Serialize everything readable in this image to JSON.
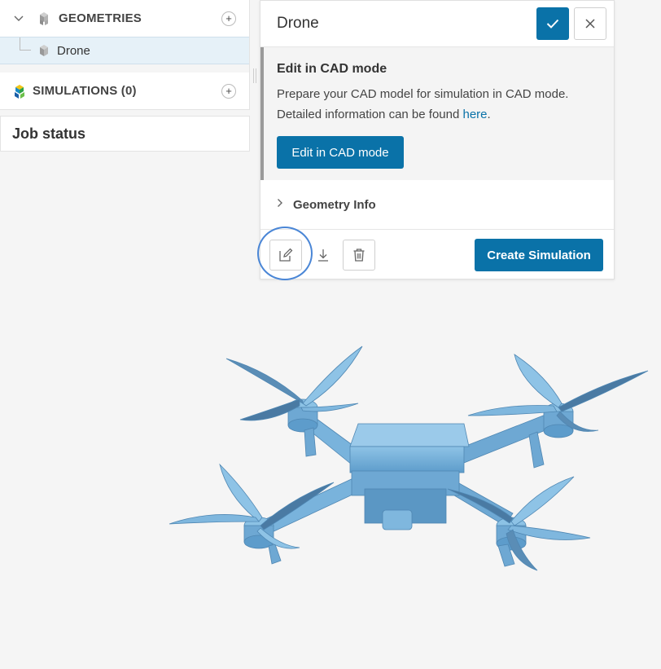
{
  "tree": {
    "geometries": {
      "title": "GEOMETRIES",
      "add_label": "+"
    },
    "geometry_items": [
      {
        "label": "Drone"
      }
    ],
    "simulations": {
      "title": "SIMULATIONS (0)",
      "add_label": "+"
    }
  },
  "job_status": {
    "title": "Job status"
  },
  "dialog": {
    "title": "Drone",
    "cad": {
      "title": "Edit in CAD mode",
      "description_1": "Prepare your CAD model for simulation in CAD mode.",
      "description_2": "Detailed information can be found ",
      "link_text": "here",
      "suffix": ".",
      "button_label": "Edit in CAD mode"
    },
    "geometry_info_label": "Geometry Info",
    "create_simulation_label": "Create Simulation"
  },
  "icons": {
    "confirm": "check-icon",
    "close": "close-icon",
    "edit": "pencil-icon",
    "download": "download-icon",
    "delete": "trash-icon"
  },
  "colors": {
    "primary": "#0a72a8",
    "selected_row": "#e6f1f8",
    "model": "#7fb7de",
    "highlight": "#4a86d6"
  }
}
